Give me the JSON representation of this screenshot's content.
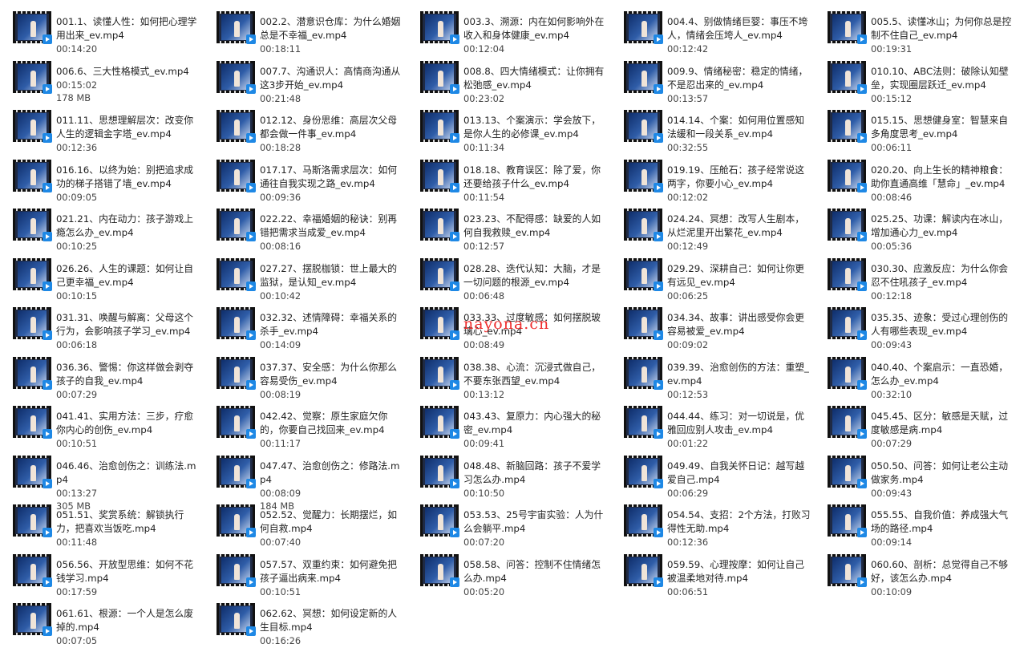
{
  "files": [
    {
      "name": "001.1、读懂人性：如何把心理学用出来_ev.mp4",
      "duration": "00:14:20"
    },
    {
      "name": "002.2、潜意识仓库：为什么婚姻总是不幸福_ev.mp4",
      "duration": "00:18:11"
    },
    {
      "name": "003.3、溯源：内在如何影响外在收入和身体健康_ev.mp4",
      "duration": "00:12:04"
    },
    {
      "name": "004.4、别做情绪巨婴：事压不垮人，情绪会压垮人_ev.mp4",
      "duration": "00:12:42"
    },
    {
      "name": "005.5、读懂冰山；为何你总是控制不住自己_ev.mp4",
      "duration": "00:19:31"
    },
    {
      "name": "006.6、三大性格模式_ev.mp4",
      "duration": "00:15:02",
      "size": "178 MB"
    },
    {
      "name": "007.7、沟通识人：高情商沟通从这3步开始_ev.mp4",
      "duration": "00:21:48"
    },
    {
      "name": "008.8、四大情绪模式：让你拥有松弛感_ev.mp4",
      "duration": "00:23:02"
    },
    {
      "name": "009.9、情绪秘密：稳定的情绪，不是忍出来的_ev.mp4",
      "duration": "00:13:57"
    },
    {
      "name": "010.10、ABC法则：破除认知壁垒，实现圈层跃迁_ev.mp4",
      "duration": "00:15:12"
    },
    {
      "name": "011.11、思想理解层次：改变你人生的逻辑金字塔_ev.mp4",
      "duration": "00:12:36"
    },
    {
      "name": "012.12、身份思维：高层次父母都会做一件事_ev.mp4",
      "duration": "00:18:28"
    },
    {
      "name": "013.13、个案演示：学会放下，是你人生的必修课_ev.mp4",
      "duration": "00:11:34"
    },
    {
      "name": "014.14、个案：如何用位置感知法缓和一段关系_ev.mp4",
      "duration": "00:32:55"
    },
    {
      "name": "015.15、思想健身室：智慧来自多角度思考_ev.mp4",
      "duration": "00:06:11"
    },
    {
      "name": "016.16、以终为始：别把追求成功的梯子搭错了墙_ev.mp4",
      "duration": "00:09:05"
    },
    {
      "name": "017.17、马斯洛需求层次：如何通往自我实现之路_ev.mp4",
      "duration": "00:09:36"
    },
    {
      "name": "018.18、教育误区：除了爱，你还要给孩子什么_ev.mp4",
      "duration": "00:11:54"
    },
    {
      "name": "019.19、压舱石：孩子经常说这两字，你要小心_ev.mp4",
      "duration": "00:12:02"
    },
    {
      "name": "020.20、向上生长的精神粮食：助你直通高维「慧命」_ev.mp4",
      "duration": "00:08:46"
    },
    {
      "name": "021.21、内在动力：孩子游戏上瘾怎么办_ev.mp4",
      "duration": "00:10:25"
    },
    {
      "name": "022.22、幸福婚姻的秘诀：别再错把需求当成爱_ev.mp4",
      "duration": "00:08:16"
    },
    {
      "name": "023.23、不配得感：缺爱的人如何自我救赎_ev.mp4",
      "duration": "00:12:57"
    },
    {
      "name": "024.24、冥想：改写人生剧本，从烂泥里开出繁花_ev.mp4",
      "duration": "00:12:49"
    },
    {
      "name": "025.25、功课：解读内在冰山，增加通心力_ev.mp4",
      "duration": "00:05:36"
    },
    {
      "name": "026.26、人生的课题：如何让自己更幸福_ev.mp4",
      "duration": "00:10:15"
    },
    {
      "name": "027.27、摆脱枷锁：世上最大的监狱，是认知_ev.mp4",
      "duration": "00:10:42"
    },
    {
      "name": "028.28、迭代认知：大脑，才是一切问题的根源_ev.mp4",
      "duration": "00:06:48"
    },
    {
      "name": "029.29、深耕自己：如何让你更有远见_ev.mp4",
      "duration": "00:06:25"
    },
    {
      "name": "030.30、应激反应：为什么你会忍不住吼孩子_ev.mp4",
      "duration": "00:12:18"
    },
    {
      "name": "031.31、唤醒与解离：父母这个行为，会影响孩子学习_ev.mp4",
      "duration": "00:06:18"
    },
    {
      "name": "032.32、述情障碍：幸福关系的杀手_ev.mp4",
      "duration": "00:14:09"
    },
    {
      "name": "033.33、过度敏感：如何摆脱玻璃心_ev.mp4",
      "duration": "00:08:49"
    },
    {
      "name": "034.34、故事：讲出感受你会更容易被爱_ev.mp4",
      "duration": "00:09:02"
    },
    {
      "name": "035.35、迹象：受过心理创伤的人有哪些表现_ev.mp4",
      "duration": "00:09:43"
    },
    {
      "name": "036.36、警惕：你这样做会剥夺孩子的自我_ev.mp4",
      "duration": "00:07:29"
    },
    {
      "name": "037.37、安全感：为什么你那么容易受伤_ev.mp4",
      "duration": "00:08:19"
    },
    {
      "name": "038.38、心流：沉浸式做自己，不要东张西望_ev.mp4",
      "duration": "00:13:12"
    },
    {
      "name": "039.39、治愈创伤的方法：重塑_ev.mp4",
      "duration": "00:12:53"
    },
    {
      "name": "040.40、个案启示：一直恐婚，怎么办_ev.mp4",
      "duration": "00:32:10"
    },
    {
      "name": "041.41、实用方法：三步，疗愈你内心的创伤_ev.mp4",
      "duration": "00:10:51"
    },
    {
      "name": "042.42、觉察：原生家庭欠你的，你要自己找回来_ev.mp4",
      "duration": "00:11:17"
    },
    {
      "name": "043.43、复原力：内心强大的秘密_ev.mp4",
      "duration": "00:09:41"
    },
    {
      "name": "044.44、练习：对一切说是，优雅回应别人攻击_ev.mp4",
      "duration": "00:01:22"
    },
    {
      "name": "045.45、区分：敏感是天赋，过度敏感是病.mp4",
      "duration": "00:07:29"
    },
    {
      "name": "046.46、治愈创伤之：训练法.mp4",
      "duration": "00:13:27",
      "size": "305 MB"
    },
    {
      "name": "047.47、治愈创伤之：修路法.mp4",
      "duration": "00:08:09",
      "size": "184 MB"
    },
    {
      "name": "048.48、新脑回路：孩子不爱学习怎么办.mp4",
      "duration": "00:10:50"
    },
    {
      "name": "049.49、自我关怀日记：越写越爱自己.mp4",
      "duration": "00:06:29"
    },
    {
      "name": "050.50、问答：如何让老公主动做家务.mp4",
      "duration": "00:09:43"
    },
    {
      "name": "051.51、奖赏系统：解锁执行力，把喜欢当饭吃.mp4",
      "duration": "00:11:48"
    },
    {
      "name": "052.52、觉醒力：长期摆烂，如何自救.mp4",
      "duration": "00:07:40"
    },
    {
      "name": "053.53、25号宇宙实验：人为什么会躺平.mp4",
      "duration": "00:07:20"
    },
    {
      "name": "054.54、支招：2个方法，打败习得性无助.mp4",
      "duration": "00:12:36"
    },
    {
      "name": "055.55、自我价值：养成强大气场的路径.mp4",
      "duration": "00:09:14"
    },
    {
      "name": "056.56、开放型思维：如何不花钱学习.mp4",
      "duration": "00:17:59"
    },
    {
      "name": "057.57、双重约束：如何避免把孩子逼出病来.mp4",
      "duration": "00:10:51"
    },
    {
      "name": "058.58、问答：控制不住情绪怎么办.mp4",
      "duration": "00:05:20"
    },
    {
      "name": "059.59、心理按摩：如何让自己被温柔地对待.mp4",
      "duration": "00:06:51"
    },
    {
      "name": "060.60、剖析：总觉得自己不够好，该怎么办.mp4",
      "duration": "00:10:09"
    },
    {
      "name": "061.61、根源：一个人是怎么废掉的.mp4",
      "duration": "00:07:05"
    },
    {
      "name": "062.62、冥想：如何设定新的人生目标.mp4",
      "duration": "00:16:26"
    }
  ],
  "watermark": "nayona.cn",
  "icons": {
    "video": "video-thumbnail-icon",
    "play": "play-badge-icon"
  }
}
